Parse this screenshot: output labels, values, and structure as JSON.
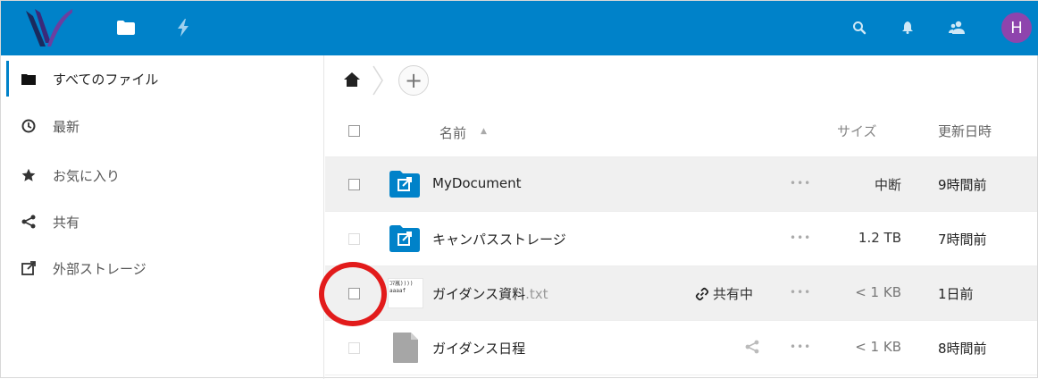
{
  "header": {
    "nav": [
      {
        "icon": "files-icon",
        "active": true
      },
      {
        "icon": "activity-icon",
        "active": false
      }
    ],
    "actions": [
      {
        "icon": "search-icon"
      },
      {
        "icon": "notifications-icon"
      },
      {
        "icon": "contacts-icon"
      }
    ],
    "avatar_initial": "H",
    "brand_color": "#0082c9"
  },
  "sidebar": {
    "items": [
      {
        "label": "すべてのファイル",
        "icon": "folder-icon",
        "active": true
      },
      {
        "label": "最新",
        "icon": "clock-icon",
        "active": false
      },
      {
        "label": "お気に入り",
        "icon": "star-icon",
        "active": false
      },
      {
        "label": "共有",
        "icon": "share-icon",
        "active": false
      },
      {
        "label": "外部ストレージ",
        "icon": "external-link-icon",
        "active": false
      }
    ]
  },
  "breadcrumb": {
    "home_icon": "home-icon",
    "add_label": "+"
  },
  "table": {
    "columns": {
      "name": "名前",
      "size": "サイズ",
      "modified": "更新日時"
    },
    "rows": [
      {
        "name": "MyDocument",
        "ext": "",
        "type": "external-folder",
        "shared_label": "",
        "size": "中断",
        "modified": "9時間前"
      },
      {
        "name": "キャンパスストレージ",
        "ext": "",
        "type": "external-folder",
        "shared_label": "",
        "size": "1.2 TB",
        "modified": "7時間前"
      },
      {
        "name": "ガイダンス資料",
        "ext": ".txt",
        "type": "text-file",
        "shared_label": "共有中",
        "size": "< 1 KB",
        "modified": "1日前",
        "thumb_lines": [
          "ｺﾏ嵐))))",
          "",
          "aaaaf"
        ]
      },
      {
        "name": "ガイダンス日程",
        "ext": "",
        "type": "file",
        "shared_label": "",
        "size": "< 1 KB",
        "modified": "8時間前"
      }
    ],
    "more_glyph": "•••"
  },
  "annotation": {
    "color": "#e21b1b"
  }
}
